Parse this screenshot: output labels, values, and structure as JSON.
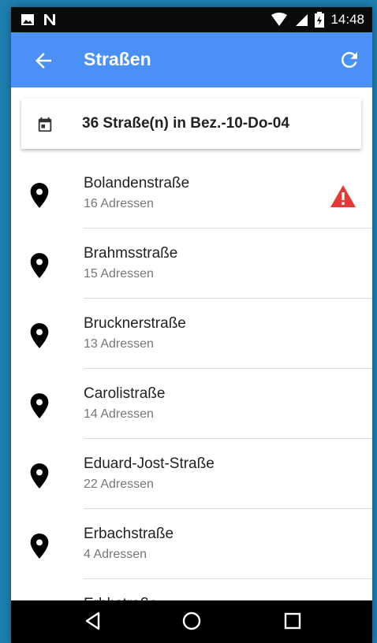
{
  "status_bar": {
    "time": "14:48",
    "icons": [
      "image-icon",
      "notification-n-icon",
      "wifi-icon",
      "signal-icon",
      "battery-icon"
    ]
  },
  "app_bar": {
    "title": "Straßen",
    "back_icon": "arrow-back-icon",
    "refresh_icon": "refresh-icon",
    "color": "#4a90f7"
  },
  "summary": {
    "icon": "calendar-icon",
    "text": "36 Straße(n) in Bez.-10-Do-04"
  },
  "streets": [
    {
      "name": "Bolandenstraße",
      "count": "16 Adressen",
      "warning": true
    },
    {
      "name": "Brahmsstraße",
      "count": "15 Adressen",
      "warning": false
    },
    {
      "name": "Brucknerstraße",
      "count": "13 Adressen",
      "warning": false
    },
    {
      "name": "Carolistraße",
      "count": "14 Adressen",
      "warning": false
    },
    {
      "name": "Eduard-Jost-Straße",
      "count": "22 Adressen",
      "warning": false
    },
    {
      "name": "Erbachstraße",
      "count": "4 Adressen",
      "warning": false
    },
    {
      "name": "Erbhstraße",
      "count": "",
      "warning": false
    }
  ],
  "nav_bar": {
    "icons": [
      "back-triangle-icon",
      "home-circle-icon",
      "recents-square-icon"
    ]
  },
  "colors": {
    "warning": "#e53935",
    "background": "#1e7fb0"
  }
}
